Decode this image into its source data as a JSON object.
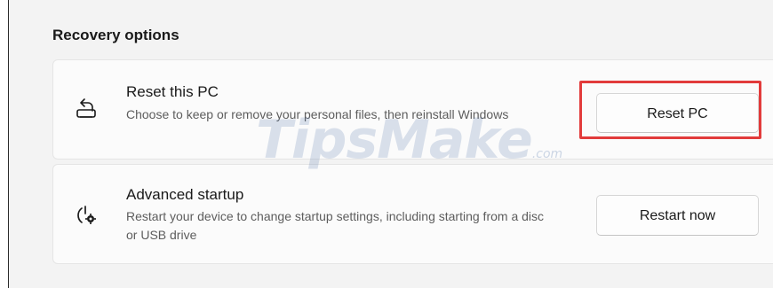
{
  "section": {
    "title": "Recovery options"
  },
  "reset_card": {
    "icon": "reset-pc-icon",
    "title": "Reset this PC",
    "description": "Choose to keep or remove your personal files, then reinstall Windows",
    "button_label": "Reset PC"
  },
  "advanced_card": {
    "icon": "advanced-startup-icon",
    "title": "Advanced startup",
    "description": "Restart your device to change startup settings, including starting from a disc or USB drive",
    "button_label": "Restart now"
  },
  "watermark": {
    "brand": "TipsMake",
    "suffix": ".com"
  },
  "colors": {
    "highlight": "#e23b3b",
    "background": "#f3f3f3",
    "card": "#fbfbfb"
  }
}
